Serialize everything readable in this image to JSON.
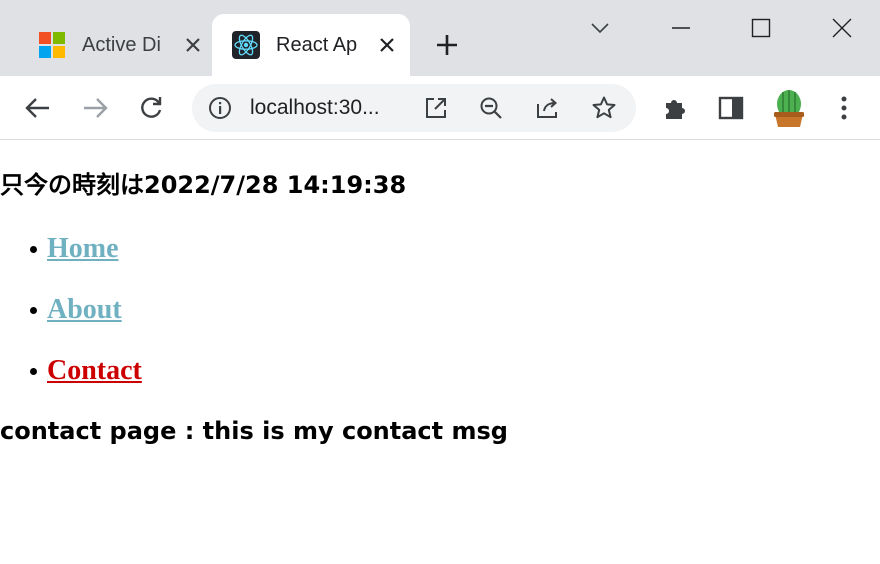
{
  "browser": {
    "tabs": [
      {
        "title": "Active Di",
        "favicon": "microsoft-logo-icon",
        "active": false
      },
      {
        "title": "React Ap",
        "favicon": "react-logo-icon",
        "active": true
      }
    ],
    "address_bar": {
      "url": "localhost:30..."
    },
    "colors": {
      "tabstrip": "#dfe1e5",
      "toolbar": "#ffffff",
      "omnibox": "#f1f3f4"
    }
  },
  "page": {
    "clock_text": "只今の時刻は2022/7/28 14:19:38",
    "nav_links": [
      {
        "label": "Home",
        "active": false,
        "color": "#6fb1c0"
      },
      {
        "label": "About",
        "active": false,
        "color": "#6fb1c0"
      },
      {
        "label": "Contact",
        "active": true,
        "color": "#cc0000"
      }
    ],
    "message": "contact page : this is my contact msg"
  }
}
